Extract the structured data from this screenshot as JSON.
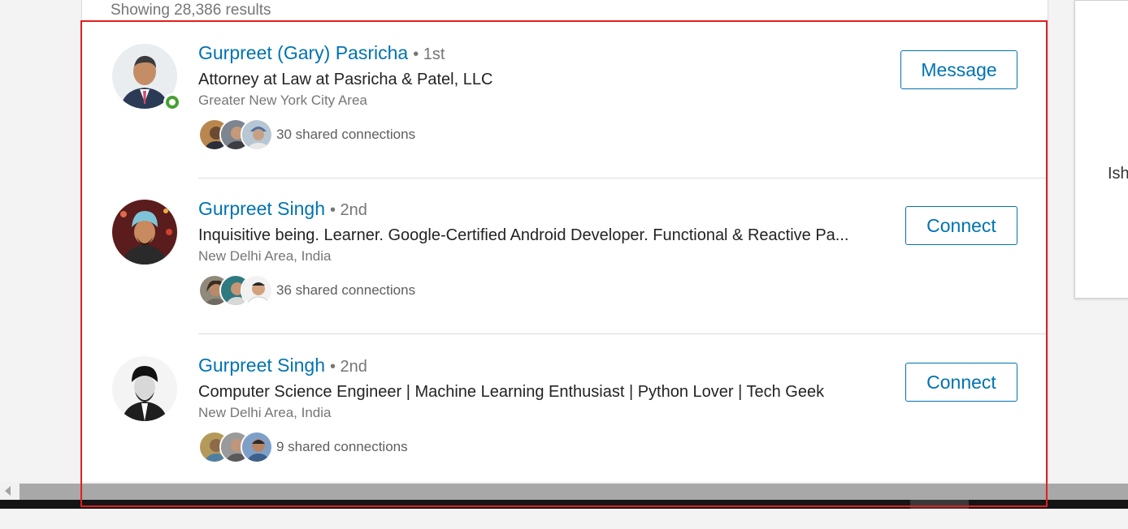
{
  "results_header": {
    "count_text": "Showing 28,386 results"
  },
  "results": [
    {
      "name": "Gurpreet (Gary) Pasricha",
      "degree": "• 1st",
      "headline": "Attorney at Law at Pasricha & Patel, LLC",
      "location": "Greater New York City Area",
      "shared_connections": "30 shared connections",
      "action_label": "Message",
      "online": true
    },
    {
      "name": "Gurpreet Singh",
      "degree": "• 2nd",
      "headline": "Inquisitive being. Learner. Google-Certified Android Developer. Functional & Reactive Pa...",
      "location": "New Delhi Area, India",
      "shared_connections": "36 shared connections",
      "action_label": "Connect",
      "online": false
    },
    {
      "name": "Gurpreet Singh",
      "degree": "• 2nd",
      "headline": "Computer Science Engineer | Machine Learning Enthusiast | Python Lover | Tech Geek",
      "location": "New Delhi Area, India",
      "shared_connections": "9 shared connections",
      "action_label": "Connect",
      "online": false
    }
  ],
  "side_panel": {
    "partial_text": "Ish"
  },
  "colors": {
    "link": "#0073b1",
    "online": "#46a032",
    "highlight": "#e02020"
  }
}
